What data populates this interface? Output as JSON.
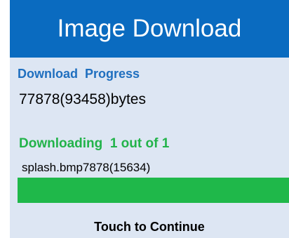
{
  "header": {
    "title": "Image Download"
  },
  "overall": {
    "label": "Download  Progress",
    "bytes_text": "77878(93458)bytes"
  },
  "current": {
    "label": "Downloading  1 out of 1",
    "file_text": "splash.bmp7878(15634)",
    "progress_fraction": 1.0
  },
  "footer": {
    "continue_label": "Touch to Continue"
  },
  "colors": {
    "header_bg": "#0a6bc0",
    "panel_bg": "#dde6f3",
    "label_blue": "#1f6fbf",
    "label_green": "#22b34a",
    "progress_green": "#1fb84a"
  }
}
